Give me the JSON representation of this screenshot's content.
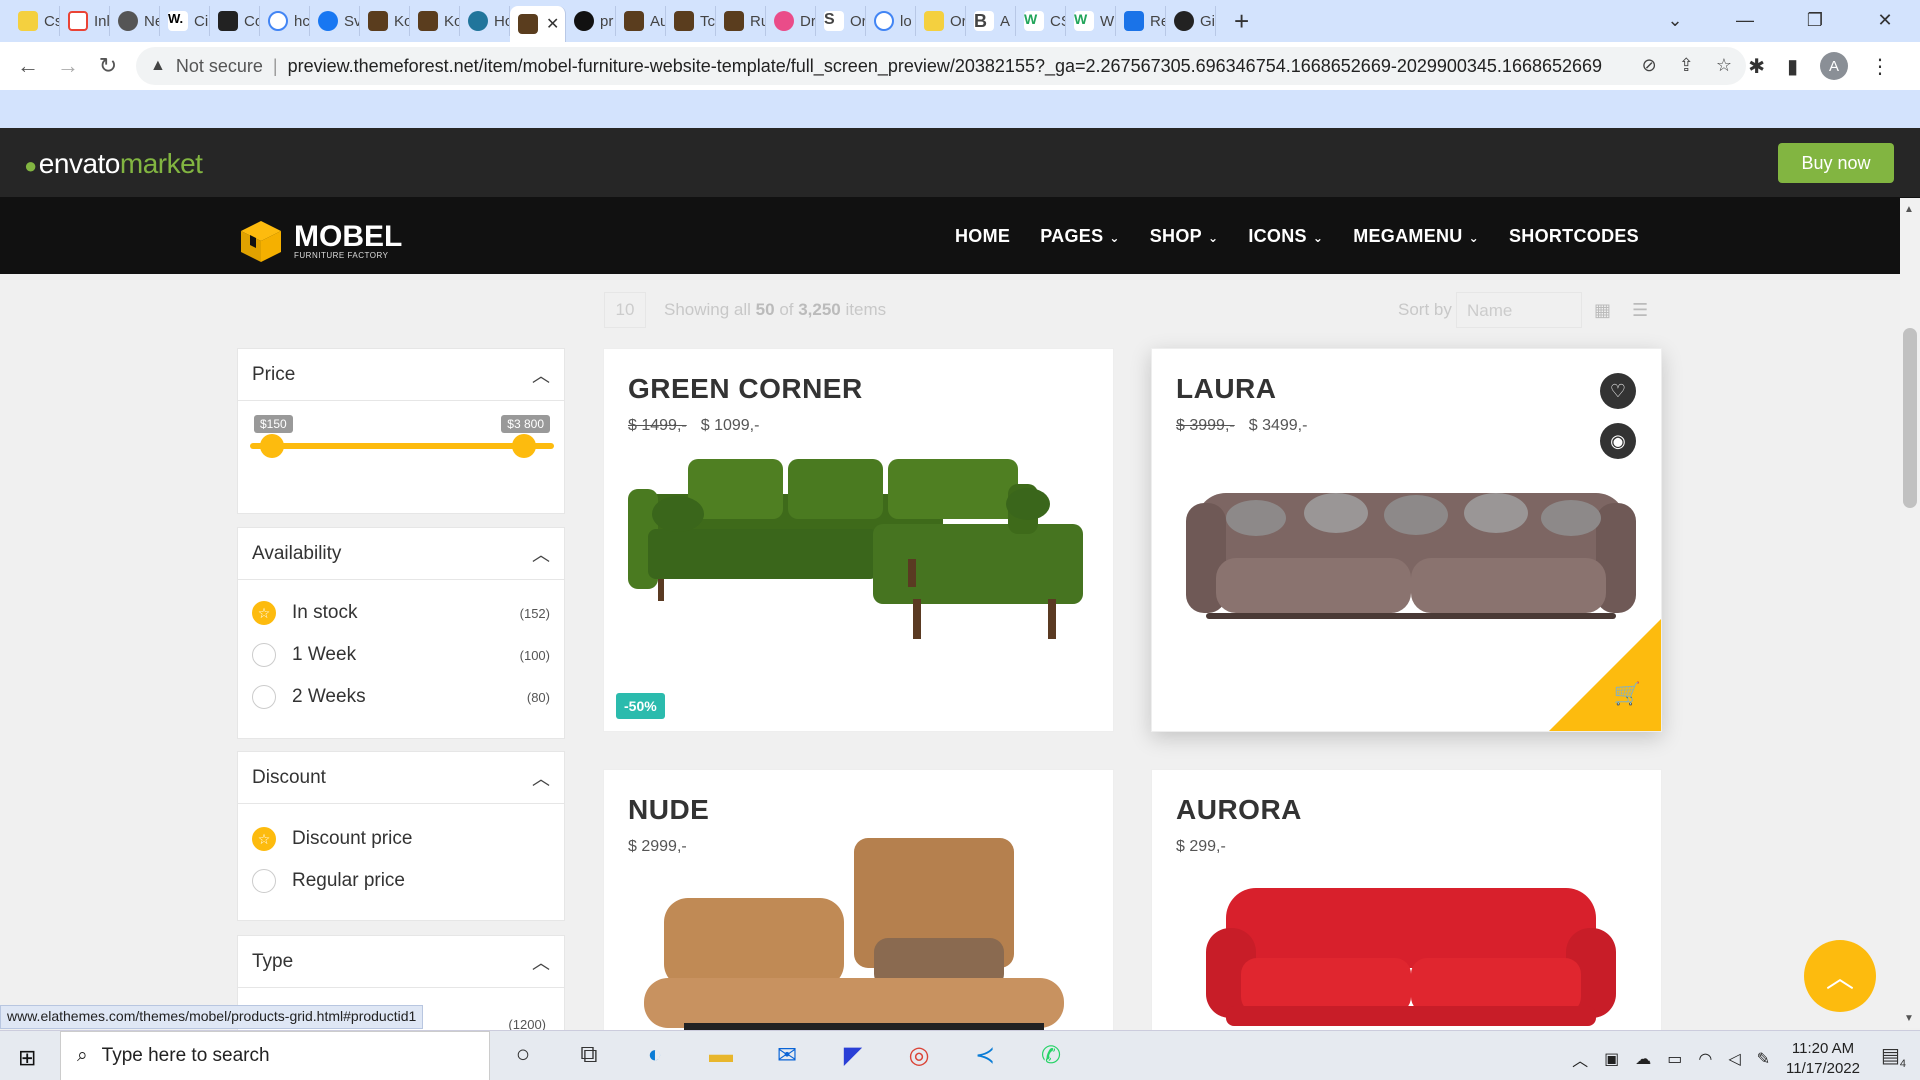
{
  "browser": {
    "tabs": [
      "Cs",
      "Inl",
      "Ne",
      "Cir",
      "Co",
      "hc",
      "Sv",
      "Ko",
      "Ko",
      "Hc",
      "",
      "pr",
      "Au",
      "Tc",
      "Ru",
      "Dr",
      "Or",
      "lo",
      "Or",
      "A",
      "CS",
      "W",
      "Re",
      "Gi"
    ],
    "new_tab": "+",
    "window_controls": [
      "⌄",
      "—",
      "❐",
      "✕"
    ],
    "security": "Not secure",
    "separator": "|",
    "url": "preview.themeforest.net/item/mobel-furniture-website-template/full_screen_preview/20382155?_ga=2.267567305.696346754.1668652669-2029900345.1668652669",
    "profile_initial": "A"
  },
  "envato": {
    "brand_a": "envato",
    "brand_b": "market",
    "buy": "Buy now"
  },
  "site": {
    "brand": "MOBEL",
    "tagline": "FURNITURE FACTORY",
    "menu": [
      {
        "label": "HOME",
        "chev": ""
      },
      {
        "label": "PAGES",
        "chev": "⌄"
      },
      {
        "label": "SHOP",
        "chev": "⌄"
      },
      {
        "label": "ICONS",
        "chev": "⌄"
      },
      {
        "label": "MEGAMENU",
        "chev": "⌄"
      },
      {
        "label": "SHORTCODES",
        "chev": ""
      }
    ]
  },
  "toolbar": {
    "per_page": "10",
    "showing_pre": "Showing all ",
    "showing_num": "50",
    "showing_of": " of ",
    "showing_total": "3,250",
    "showing_post": " items",
    "sort_label": "Sort by",
    "sort_value": "Name"
  },
  "filters": {
    "price": {
      "title": "Price",
      "min_label": "$150",
      "max_label": "$3 800"
    },
    "availability": {
      "title": "Availability",
      "options": [
        {
          "label": "In stock",
          "count": "(152)"
        },
        {
          "label": "1 Week",
          "count": "(100)"
        },
        {
          "label": "2 Weeks",
          "count": "(80)"
        }
      ]
    },
    "discount": {
      "title": "Discount",
      "options": [
        {
          "label": "Discount price"
        },
        {
          "label": "Regular price"
        }
      ]
    },
    "type": {
      "title": "Type",
      "count": "(1200)"
    }
  },
  "products": [
    {
      "name": "GREEN CORNER",
      "old_price": "$ 1499,-",
      "price": "$ 1099,-",
      "badge": "-50%"
    },
    {
      "name": "LAURA",
      "old_price": "$ 3999,-",
      "price": "$ 3499,-"
    },
    {
      "name": "NUDE",
      "price": "$ 2999,-"
    },
    {
      "name": "AURORA",
      "price": "$ 299,-"
    }
  ],
  "status_url": "www.elathemes.com/themes/mobel/products-grid.html#productid1",
  "taskbar": {
    "search_placeholder": "Type here to search",
    "time": "11:20 AM",
    "date": "11/17/2022",
    "notif_count": "4"
  },
  "colors": {
    "accent": "#fdbb0e",
    "envato_green": "#82b541",
    "badge": "#2bbbad"
  }
}
